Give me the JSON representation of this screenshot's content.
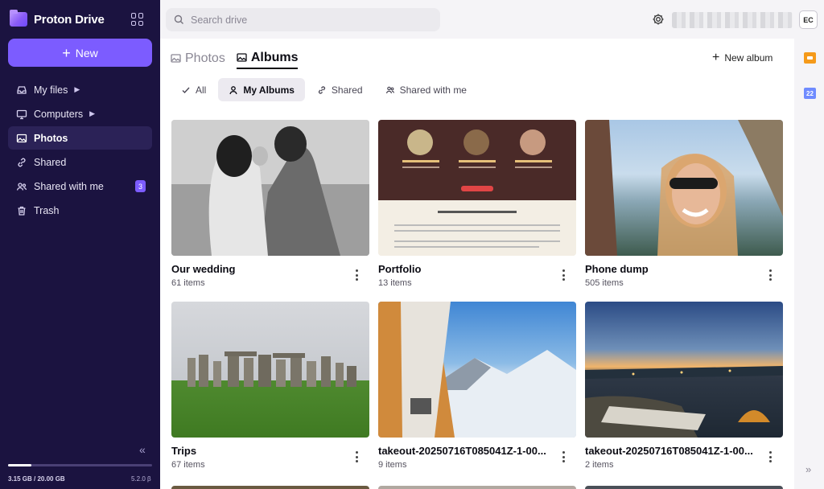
{
  "app": {
    "name": "Proton Drive"
  },
  "sidebar": {
    "new_label": "New",
    "items": [
      {
        "label": "My files",
        "icon": "inbox-icon",
        "expandable": true
      },
      {
        "label": "Computers",
        "icon": "monitor-icon",
        "expandable": true
      },
      {
        "label": "Photos",
        "icon": "image-icon",
        "active": true
      },
      {
        "label": "Shared",
        "icon": "link-icon"
      },
      {
        "label": "Shared with me",
        "icon": "users-icon",
        "badge": "3"
      },
      {
        "label": "Trash",
        "icon": "trash-icon"
      }
    ],
    "storage_text": "3.15 GB / 20.00 GB",
    "storage_used_fraction": 0.16,
    "version": "5.2.0 β"
  },
  "topbar": {
    "search_placeholder": "Search drive",
    "avatar_initials": "EC"
  },
  "main": {
    "view_tabs": [
      {
        "label": "Photos",
        "active": false
      },
      {
        "label": "Albums",
        "active": true
      }
    ],
    "new_album_label": "New album",
    "filters": [
      {
        "label": "All"
      },
      {
        "label": "My Albums",
        "active": true
      },
      {
        "label": "Shared"
      },
      {
        "label": "Shared with me"
      }
    ],
    "albums": [
      {
        "title": "Our wedding",
        "count": "61 items"
      },
      {
        "title": "Portfolio",
        "count": "13 items"
      },
      {
        "title": "Phone dump",
        "count": "505 items"
      },
      {
        "title": "Trips",
        "count": "67 items"
      },
      {
        "title": "takeout-20250716T085041Z-1-00...",
        "count": "9 items"
      },
      {
        "title": "takeout-20250716T085041Z-1-00...",
        "count": "2 items"
      }
    ]
  },
  "right_rail": {
    "calendar_day": "22"
  },
  "colors": {
    "sidebar_bg": "#1b1340",
    "accent": "#7c5cff",
    "panel_bg": "#f5f4f7"
  }
}
